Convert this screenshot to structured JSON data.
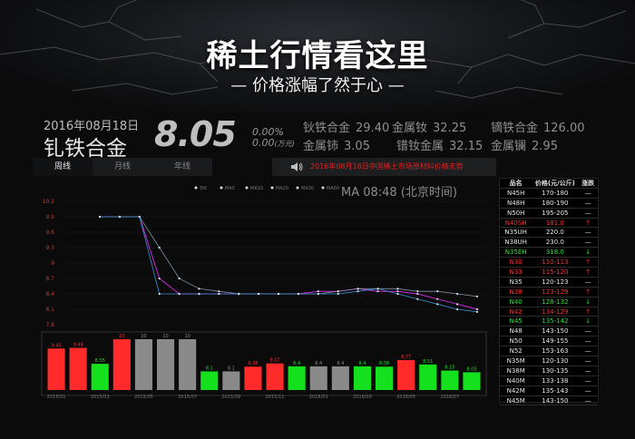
{
  "header": {
    "title": "稀土行情看这里",
    "subtitle": "— 价格涨幅了然于心 —"
  },
  "colors": {
    "up": "#ff2a2a",
    "down": "#15e01e",
    "flat": "#8a8a8a",
    "news": "#e02020"
  },
  "icons": [
    "speaker-icon"
  ],
  "info": {
    "date": "2016年08月18日",
    "product": "钆铁合金",
    "price": "8.05",
    "change": "0.00%",
    "change_amount": "0.00",
    "change_unit": "(万元)",
    "related": [
      {
        "name": "钬铁合金",
        "value": "29.40"
      },
      {
        "name": "金属钕",
        "value": "32.25"
      },
      {
        "name": "镝铁合金",
        "value": "126.00"
      },
      {
        "name": "金属铈",
        "value": "3.05"
      },
      {
        "name": "镨钕金属",
        "value": "32.15"
      },
      {
        "name": "金属镧",
        "value": "2.95"
      }
    ]
  },
  "tabs": [
    "周线",
    "月线",
    "年线"
  ],
  "news": "2016年08月18日中国稀土市场原材料价格走势",
  "chart_data": [
    {
      "type": "line",
      "x": [
        0,
        1,
        2,
        3,
        4,
        5,
        6,
        7,
        8,
        9,
        10,
        11,
        12,
        13,
        14,
        15,
        16,
        17,
        18,
        19
      ],
      "ylim": [
        7.8,
        10.2
      ],
      "yticks": [
        "10.2",
        "9.9",
        "9.6",
        "9.3",
        "9",
        "8.7",
        "8.4",
        "8.1",
        "7.8"
      ],
      "legend": [
        "日K",
        "MA5",
        "MA10",
        "MA20",
        "MA30",
        "MA60"
      ],
      "series": [
        {
          "name": "MA5",
          "values": [
            9.9,
            9.9,
            9.9,
            8.7,
            8.4,
            8.4,
            8.4,
            8.4,
            8.4,
            8.4,
            8.4,
            8.45,
            8.45,
            8.5,
            8.45,
            8.45,
            8.4,
            8.3,
            8.2,
            8.1
          ]
        },
        {
          "name": "MA10",
          "values": [
            9.9,
            9.9,
            9.9,
            9.3,
            8.7,
            8.5,
            8.45,
            8.4,
            8.4,
            8.4,
            8.4,
            8.4,
            8.45,
            8.5,
            8.5,
            8.5,
            8.45,
            8.45,
            8.4,
            8.35
          ]
        },
        {
          "name": "MA60",
          "values": [
            9.9,
            9.9,
            9.9,
            8.4,
            8.4,
            8.4,
            8.4,
            8.4,
            8.4,
            8.4,
            8.4,
            8.4,
            8.4,
            8.45,
            8.5,
            8.4,
            8.3,
            8.2,
            8.1,
            8.05
          ]
        }
      ],
      "time_label": "MA 08:48 (北京时间)"
    },
    {
      "type": "bar",
      "categories": [
        "2015/01",
        "",
        "2015/03",
        "",
        "2015/05",
        "",
        "2015/07",
        "",
        "2015/09",
        "",
        "2015/11",
        "",
        "2016/01",
        "",
        "2016/03",
        "",
        "2016/05",
        "",
        "2016/07",
        ""
      ],
      "x_ticks": [
        "2015/01",
        "2015/03",
        "2015/05",
        "2015/07",
        "2015/09",
        "2015/11",
        "2016/01",
        "2016/03",
        "2016/05",
        "2016/07"
      ],
      "values": [
        9.45,
        9.49,
        8.55,
        10,
        10,
        10,
        10,
        8.1,
        8.1,
        8.38,
        8.57,
        8.4,
        8.4,
        8.4,
        8.4,
        8.38,
        8.77,
        8.51,
        8.15,
        8.05
      ],
      "labels": [
        "9.45",
        "9.49",
        "8.55",
        "10",
        "10",
        "10",
        "10",
        "8.1",
        "8.1",
        "8.38",
        "8.57",
        "8.4",
        "8.4",
        "8.4",
        "8.4",
        "8.38",
        "8.77",
        "8.51",
        "8.15",
        "8.05"
      ],
      "trend": [
        "up",
        "up",
        "down",
        "up",
        "flat",
        "flat",
        "flat",
        "down",
        "flat",
        "up",
        "up",
        "down",
        "flat",
        "flat",
        "down",
        "down",
        "up",
        "down",
        "down",
        "down"
      ]
    }
  ],
  "price_table": {
    "headers": [
      "品名",
      "价格(元/公斤)",
      "涨跌"
    ],
    "rows": [
      {
        "name": "N45H",
        "price": "170-180",
        "trend": "—",
        "color": "white"
      },
      {
        "name": "N48H",
        "price": "180-190",
        "trend": "—",
        "color": "white"
      },
      {
        "name": "N50H",
        "price": "195-205",
        "trend": "—",
        "color": "white"
      },
      {
        "name": "N40SH",
        "price": "181.0",
        "trend": "↑",
        "color": "red"
      },
      {
        "name": "N35UH",
        "price": "220.0",
        "trend": "—",
        "color": "white"
      },
      {
        "name": "N38UH",
        "price": "230.0",
        "trend": "—",
        "color": "white"
      },
      {
        "name": "N35EH",
        "price": "318.0",
        "trend": "↓",
        "color": "green"
      },
      {
        "name": "N30",
        "price": "110-113",
        "trend": "↑",
        "color": "red"
      },
      {
        "name": "N33",
        "price": "115-120",
        "trend": "↑",
        "color": "red"
      },
      {
        "name": "N35",
        "price": "120-123",
        "trend": "—",
        "color": "white"
      },
      {
        "name": "N38",
        "price": "123-129",
        "trend": "↑",
        "color": "red"
      },
      {
        "name": "N40",
        "price": "128-132",
        "trend": "↓",
        "color": "green"
      },
      {
        "name": "N42",
        "price": "134-129",
        "trend": "↑",
        "color": "red"
      },
      {
        "name": "N45",
        "price": "135-142",
        "trend": "↓",
        "color": "green"
      },
      {
        "name": "N48",
        "price": "143-150",
        "trend": "—",
        "color": "white"
      },
      {
        "name": "N50",
        "price": "149-155",
        "trend": "—",
        "color": "white"
      },
      {
        "name": "N52",
        "price": "153-163",
        "trend": "—",
        "color": "white"
      },
      {
        "name": "N35M",
        "price": "120-130",
        "trend": "—",
        "color": "white"
      },
      {
        "name": "N38M",
        "price": "130-135",
        "trend": "—",
        "color": "white"
      },
      {
        "name": "N40M",
        "price": "133-138",
        "trend": "—",
        "color": "white"
      },
      {
        "name": "N42M",
        "price": "135-143",
        "trend": "—",
        "color": "white"
      },
      {
        "name": "N45M",
        "price": "143-150",
        "trend": "—",
        "color": "white"
      }
    ]
  }
}
